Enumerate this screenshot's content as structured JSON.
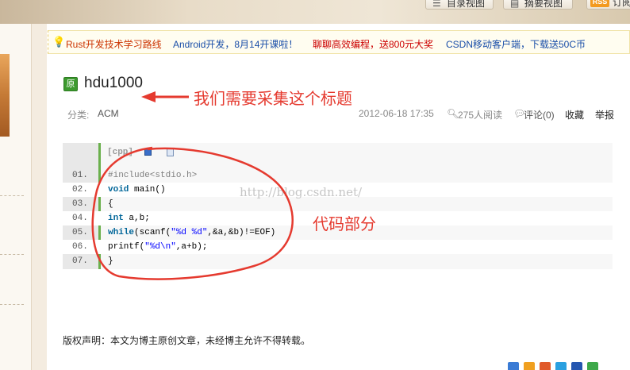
{
  "header": {
    "directory_view_label": "目录视图",
    "summary_view_label": "摘要视图",
    "rss_badge": "RSS",
    "subscribe_label": "订阅"
  },
  "announcements": [
    {
      "text": "Rust开发技术学习路线",
      "color": "#cc3300"
    },
    {
      "text": "Android开发，8月14开课啦！",
      "color": "#1a4ea8"
    },
    {
      "text": "聊聊高效编程，送800元大奖",
      "color": "#cc0000"
    },
    {
      "text": "CSDN移动客户端，下载送50C币",
      "color": "#1a4ea8"
    }
  ],
  "post": {
    "original_badge": "原",
    "title": "hdu1000",
    "category_label": "分类:",
    "category": "ACM",
    "date": "2012-06-18 17:35",
    "read_count": "275人阅读",
    "comment_label": "评论(0)",
    "favorite_label": "收藏",
    "report_label": "举报"
  },
  "code": {
    "lang_tag": "[cpp]",
    "line_numbers": [
      "01.",
      "02.",
      "03.",
      "04.",
      "05.",
      "06.",
      "07."
    ],
    "lines": [
      "#include<stdio.h>",
      "void main()",
      "{",
      "int a,b;",
      "while(scanf(\"%d %d\",&a,&b)!=EOF)",
      "printf(\"%d\\n\",a+b);",
      "}"
    ]
  },
  "watermark": "http://blog.csdn.net/",
  "annotations": {
    "title_note": "我们需要采集这个标题",
    "code_note": "代码部分"
  },
  "copyright": "版权声明：本文为博主原创文章，未经博主允许不得转载。",
  "colors": {
    "annotation_red": "#e53a2f",
    "code_accent_green": "#6ab04c",
    "original_badge_green": "#3c9a2e"
  }
}
